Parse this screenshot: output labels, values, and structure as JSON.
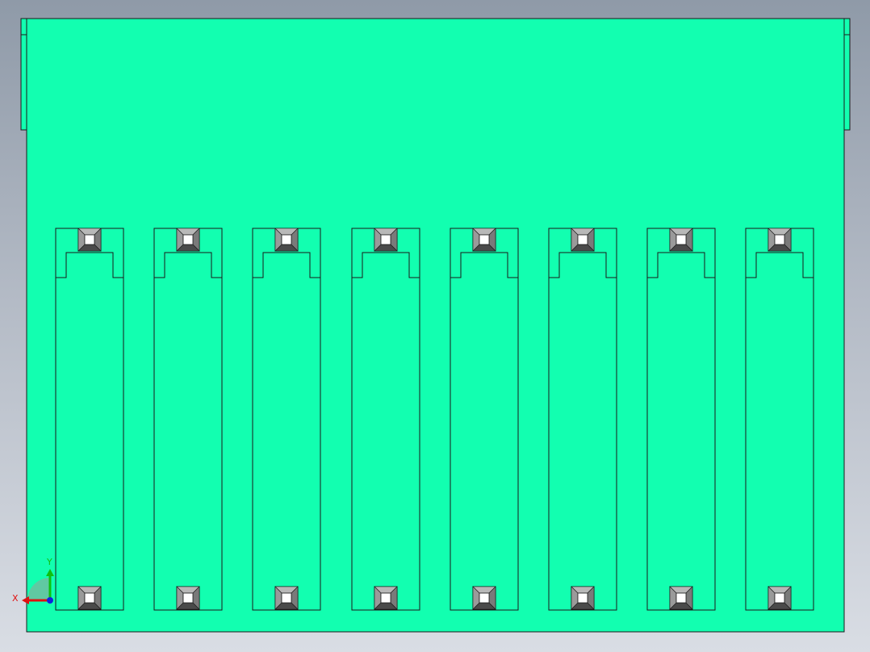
{
  "colors": {
    "background_top": "#8f9aa8",
    "background_bottom": "#d9dde4",
    "part_fill": "#12ffb0",
    "edge_line": "#1a1a1a",
    "pin_outer": "#8c8c8c",
    "pin_light": "#b8b8b8",
    "pin_dark": "#4a4a4a",
    "pin_hole": "#ffffff",
    "axis_x": "#e01010",
    "axis_y": "#10c010",
    "axis_z": "#1020e0"
  },
  "model": {
    "description_type": "connector-front-view",
    "slot_count": 8,
    "pins_per_slot": 2
  },
  "triad": {
    "x_label": "X",
    "y_label": "Y",
    "x_icon": "axis-x-arrow-icon",
    "y_icon": "axis-y-arrow-icon",
    "z_icon": "axis-z-dot-icon"
  }
}
